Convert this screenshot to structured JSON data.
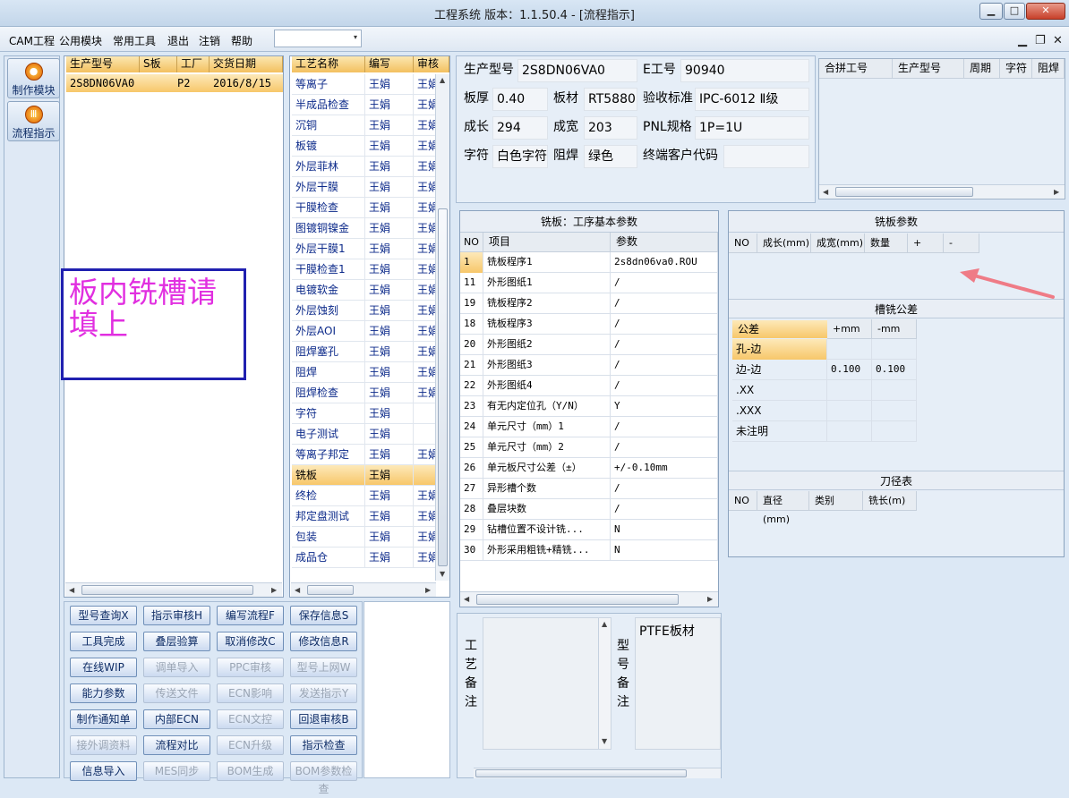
{
  "window": {
    "title": "工程系统   版本：1.1.50.4 - [流程指示]",
    "min": "▁",
    "max": "□",
    "close": "✕"
  },
  "menu": {
    "items": [
      "CAM工程",
      "公用模块",
      "常用工具",
      "退出",
      "注销",
      "帮助"
    ],
    "combo_value": "",
    "combo_arrow": "▾",
    "mdi_min": "▁",
    "mdi_restore": "❐",
    "mdi_close": "✕"
  },
  "leftnav": {
    "items": [
      {
        "label": "制作模块",
        "icon": "●"
      },
      {
        "label": "流程指示",
        "icon": "Ⅲ"
      }
    ]
  },
  "orders": {
    "headers": [
      "生产型号",
      "S板",
      "工厂",
      "交货日期"
    ],
    "rows": [
      {
        "model": "2S8DN06VA0",
        "sboard": "",
        "factory": "P2",
        "date": "2016/8/15"
      }
    ]
  },
  "note": "板内铣槽请填上",
  "process": {
    "headers": [
      "工艺名称",
      "编写",
      "审核"
    ],
    "rows": [
      {
        "name": "等离子",
        "writer": "王娟",
        "reviewer": "王娟"
      },
      {
        "name": "半成品检查",
        "writer": "王娟",
        "reviewer": "王娟"
      },
      {
        "name": "沉铜",
        "writer": "王娟",
        "reviewer": "王娟"
      },
      {
        "name": "板镀",
        "writer": "王娟",
        "reviewer": "王娟"
      },
      {
        "name": "外层菲林",
        "writer": "王娟",
        "reviewer": "王娟"
      },
      {
        "name": "外层干膜",
        "writer": "王娟",
        "reviewer": "王娟"
      },
      {
        "name": "干膜检查",
        "writer": "王娟",
        "reviewer": "王娟"
      },
      {
        "name": "图镀铜镍金",
        "writer": "王娟",
        "reviewer": "王娟"
      },
      {
        "name": "外层干膜1",
        "writer": "王娟",
        "reviewer": "王娟"
      },
      {
        "name": "干膜检查1",
        "writer": "王娟",
        "reviewer": "王娟"
      },
      {
        "name": "电镀软金",
        "writer": "王娟",
        "reviewer": "王娟"
      },
      {
        "name": "外层蚀刻",
        "writer": "王娟",
        "reviewer": "王娟"
      },
      {
        "name": "外层AOI",
        "writer": "王娟",
        "reviewer": "王娟"
      },
      {
        "name": "阻焊塞孔",
        "writer": "王娟",
        "reviewer": "王娟"
      },
      {
        "name": "阻焊",
        "writer": "王娟",
        "reviewer": "王娟"
      },
      {
        "name": "阻焊检查",
        "writer": "王娟",
        "reviewer": "王娟"
      },
      {
        "name": "字符",
        "writer": "王娟",
        "reviewer": ""
      },
      {
        "name": "电子测试",
        "writer": "王娟",
        "reviewer": ""
      },
      {
        "name": "等离子邦定",
        "writer": "王娟",
        "reviewer": "王娟"
      },
      {
        "name": "铣板",
        "writer": "王娟",
        "reviewer": ""
      },
      {
        "name": "终检",
        "writer": "王娟",
        "reviewer": "王娟"
      },
      {
        "name": "邦定盘测试",
        "writer": "王娟",
        "reviewer": "王娟"
      },
      {
        "name": "包装",
        "writer": "王娟",
        "reviewer": "王娟"
      },
      {
        "name": "成品仓",
        "writer": "王娟",
        "reviewer": "王娟"
      }
    ],
    "selected": "铣板"
  },
  "buttons": [
    {
      "label": "型号查询X",
      "enabled": true
    },
    {
      "label": "指示审核H",
      "enabled": true
    },
    {
      "label": "编写流程F",
      "enabled": true
    },
    {
      "label": "保存信息S",
      "enabled": true
    },
    {
      "label": "工具完成",
      "enabled": true
    },
    {
      "label": "叠层验算",
      "enabled": true
    },
    {
      "label": "取消修改C",
      "enabled": true
    },
    {
      "label": "修改信息R",
      "enabled": true
    },
    {
      "label": "在线WIP",
      "enabled": true
    },
    {
      "label": "调单导入",
      "enabled": false
    },
    {
      "label": "PPC审核",
      "enabled": false
    },
    {
      "label": "型号上网W",
      "enabled": false
    },
    {
      "label": "能力参数",
      "enabled": true
    },
    {
      "label": "传送文件",
      "enabled": false
    },
    {
      "label": "ECN影响",
      "enabled": false
    },
    {
      "label": "发送指示Y",
      "enabled": false
    },
    {
      "label": "制作通知单",
      "enabled": true
    },
    {
      "label": "内部ECN",
      "enabled": true
    },
    {
      "label": "ECN文控",
      "enabled": false
    },
    {
      "label": "回退审核B",
      "enabled": true
    },
    {
      "label": "接外调资料",
      "enabled": false
    },
    {
      "label": "流程对比",
      "enabled": true
    },
    {
      "label": "ECN升级",
      "enabled": false
    },
    {
      "label": "指示检查",
      "enabled": true
    },
    {
      "label": "信息导入",
      "enabled": true
    },
    {
      "label": "MES同步",
      "enabled": false
    },
    {
      "label": "BOM生成",
      "enabled": false
    },
    {
      "label": "BOM参数检查",
      "enabled": false
    }
  ],
  "info": {
    "model_label": "生产型号",
    "model": "2S8DN06VA0",
    "eno_label": "E工号",
    "eno": "90940",
    "thick_label": "板厚",
    "thick": "0.40",
    "material_label": "板材",
    "material": "RT5880",
    "std_label": "验收标准",
    "std": "IPC-6012 Ⅱ级",
    "length_label": "成长",
    "length": "294",
    "width_label": "成宽",
    "width": "203",
    "pnl_label": "PNL规格",
    "pnl": "1P=1U",
    "silk_label": "字符",
    "silk": "白色字符",
    "mask_label": "阻焊",
    "mask": "绿色",
    "cust_label": "终端客户代码",
    "cust": ""
  },
  "combine": {
    "headers": [
      "合拼工号",
      "生产型号",
      "周期",
      "字符",
      "阻焊"
    ]
  },
  "params": {
    "title": "铣板：工序基本参数",
    "headers": [
      "NO",
      "项目",
      "参数"
    ],
    "rows": [
      {
        "no": "1",
        "item": "铣板程序1",
        "value": "2s8dn06va0.ROU"
      },
      {
        "no": "11",
        "item": "外形图纸1",
        "value": "/"
      },
      {
        "no": "19",
        "item": "铣板程序2",
        "value": "/"
      },
      {
        "no": "18",
        "item": "铣板程序3",
        "value": "/"
      },
      {
        "no": "20",
        "item": "外形图纸2",
        "value": "/"
      },
      {
        "no": "21",
        "item": "外形图纸3",
        "value": "/"
      },
      {
        "no": "22",
        "item": "外形图纸4",
        "value": "/"
      },
      {
        "no": "23",
        "item": "有无内定位孔（Y/N）",
        "value": "Y"
      },
      {
        "no": "24",
        "item": "单元尺寸（mm）1",
        "value": "/"
      },
      {
        "no": "25",
        "item": "单元尺寸（mm）2",
        "value": "/"
      },
      {
        "no": "26",
        "item": "单元板尺寸公差（±）",
        "value": "+/-0.10mm"
      },
      {
        "no": "27",
        "item": "异形槽个数",
        "value": "/"
      },
      {
        "no": "28",
        "item": "叠层块数",
        "value": "/"
      },
      {
        "no": "29",
        "item": "钻槽位置不设计铣...",
        "value": "N"
      },
      {
        "no": "30",
        "item": "外形采用粗铣+精铣...",
        "value": "N"
      }
    ]
  },
  "mill": {
    "title": "铣板参数",
    "headers": [
      "NO",
      "成长(mm)",
      "成宽(mm)",
      "数量",
      "+",
      "-"
    ]
  },
  "slot": {
    "title": "槽铣公差",
    "headers": [
      "公差",
      "+mm",
      "-mm"
    ],
    "rows": [
      {
        "name": "孔-边",
        "plus": "",
        "minus": ""
      },
      {
        "name": "边-边",
        "plus": "0.100",
        "minus": "0.100"
      },
      {
        "name": ".XX",
        "plus": "",
        "minus": ""
      },
      {
        "name": ".XXX",
        "plus": "",
        "minus": ""
      },
      {
        "name": "未注明",
        "plus": "",
        "minus": ""
      }
    ]
  },
  "tools": {
    "title": "刀径表",
    "headers": [
      "NO",
      "直径(mm)",
      "类别",
      "铣长(m)"
    ]
  },
  "remarks": {
    "process_label": "工艺备注",
    "model_label": "型号备注",
    "model_text": "PTFE板材"
  }
}
